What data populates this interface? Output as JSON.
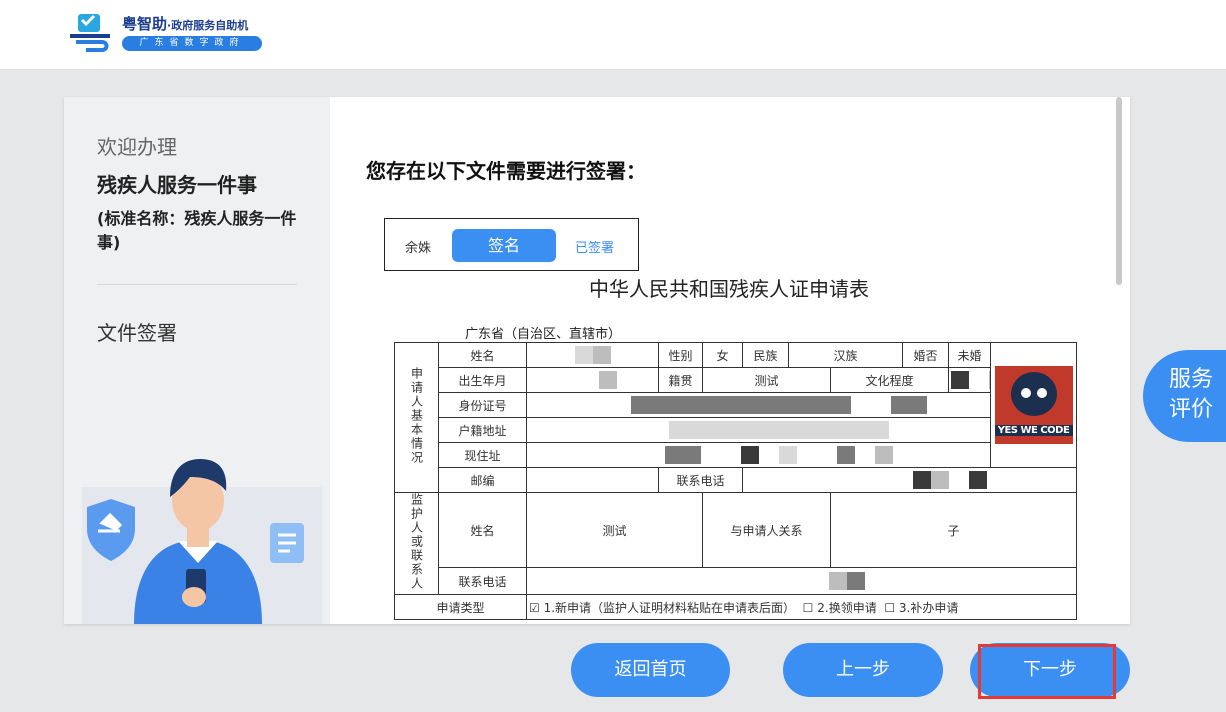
{
  "header": {
    "brand": "粤智助",
    "brand_sub": "·政府服务自助机",
    "pill": "广东省数字政府"
  },
  "left": {
    "welcome": "欢迎办理",
    "service_name": "残疾人服务一件事",
    "standard_name": "(标准名称：残疾人服务一件事)",
    "step": "文件签署"
  },
  "main": {
    "heading": "您存在以下文件需要进行签署：",
    "signer_name": "余姝",
    "sign_button": "签名",
    "signed_label": "已签署",
    "form_title": "中华人民共和国残疾人证申请表",
    "region": "广东省（自治区、直辖市）",
    "form": {
      "applicant_group": "申请人基本情况",
      "name": "姓名",
      "gender": "性别",
      "gender_value": "女",
      "ethnicity": "民族",
      "ethnicity_value": "汉族",
      "marital": "婚否",
      "marital_value": "未婚",
      "birth": "出生年月",
      "native_place": "籍贯",
      "native_place_value": "测试",
      "education": "文化程度",
      "id_number": "身份证号",
      "household_address": "户籍地址",
      "current_address": "现住址",
      "postcode": "邮编",
      "contact_phone": "联系电话",
      "guardian_group": "监护人或联系人",
      "guardian_name": "姓名",
      "guardian_name_value": "测试",
      "relation": "与申请人关系",
      "relation_value": "子",
      "guardian_phone": "联系电话",
      "apply_type": "申请类型",
      "apply_new": "☑ 1.新申请（监护人证明材料粘贴在申请表后面）",
      "apply_renew": "☐ 2.换领申请",
      "apply_reissue": "☐ 3.补办申请",
      "photo_text": "YES WE CODE"
    }
  },
  "buttons": {
    "home": "返回首页",
    "prev": "上一步",
    "next": "下一步"
  },
  "float_eval": {
    "line1": "服务",
    "line2": "评价"
  }
}
